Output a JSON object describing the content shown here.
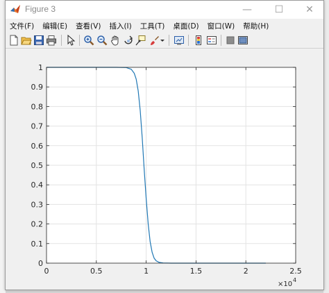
{
  "window": {
    "title": "Figure 3",
    "minimize_glyph": "—",
    "maximize_glyph": "☐",
    "close_glyph": "✕"
  },
  "menu": {
    "items": [
      {
        "label": "文件(F)"
      },
      {
        "label": "编辑(E)"
      },
      {
        "label": "查看(V)"
      },
      {
        "label": "插入(I)"
      },
      {
        "label": "工具(T)"
      },
      {
        "label": "桌面(D)"
      },
      {
        "label": "窗口(W)"
      },
      {
        "label": "帮助(H)"
      }
    ]
  },
  "toolbar": {
    "icons": [
      "new-figure-icon",
      "open-file-icon",
      "save-icon",
      "print-icon",
      "edit-plot-arrow-icon",
      "zoom-in-icon",
      "zoom-out-icon",
      "pan-hand-icon",
      "rotate-3d-icon",
      "data-cursor-icon",
      "brush-icon",
      "brush-dropdown-icon",
      "link-plot-icon",
      "insert-colorbar-icon",
      "insert-legend-icon",
      "hide-plot-tools-icon",
      "show-plot-tools-icon"
    ]
  },
  "colors": {
    "line": "#1f77b4",
    "grid": "#e3e3e3",
    "axes_bg": "#ffffff"
  },
  "chart_data": {
    "type": "line",
    "title": "",
    "xlabel": "",
    "ylabel": "",
    "xlim": [
      0,
      25000
    ],
    "ylim": [
      0,
      1
    ],
    "x_exponent_label": "×10",
    "x_exponent_power": "4",
    "x_ticks": [
      0,
      5000,
      10000,
      15000,
      20000,
      25000
    ],
    "x_tick_labels": [
      "0",
      "0.5",
      "1",
      "1.5",
      "2",
      "2.5"
    ],
    "y_ticks": [
      0,
      0.1,
      0.2,
      0.3,
      0.4,
      0.5,
      0.6,
      0.7,
      0.8,
      0.9,
      1
    ],
    "y_tick_labels": [
      "0",
      "0.1",
      "0.2",
      "0.3",
      "0.4",
      "0.5",
      "0.6",
      "0.7",
      "0.8",
      "0.9",
      "1"
    ],
    "grid": true,
    "series": [
      {
        "x": [
          0,
          7000,
          8000,
          8500,
          8800,
          9000,
          9200,
          9400,
          9600,
          9800,
          10000,
          10200,
          10400,
          10600,
          10800,
          11000,
          11300,
          11700,
          12500,
          14000,
          22000
        ],
        "y": [
          1,
          1,
          0.999,
          0.99,
          0.97,
          0.94,
          0.88,
          0.78,
          0.64,
          0.48,
          0.33,
          0.2,
          0.11,
          0.055,
          0.025,
          0.012,
          0.004,
          0.001,
          0.0,
          0.0,
          0.0
        ]
      }
    ]
  }
}
